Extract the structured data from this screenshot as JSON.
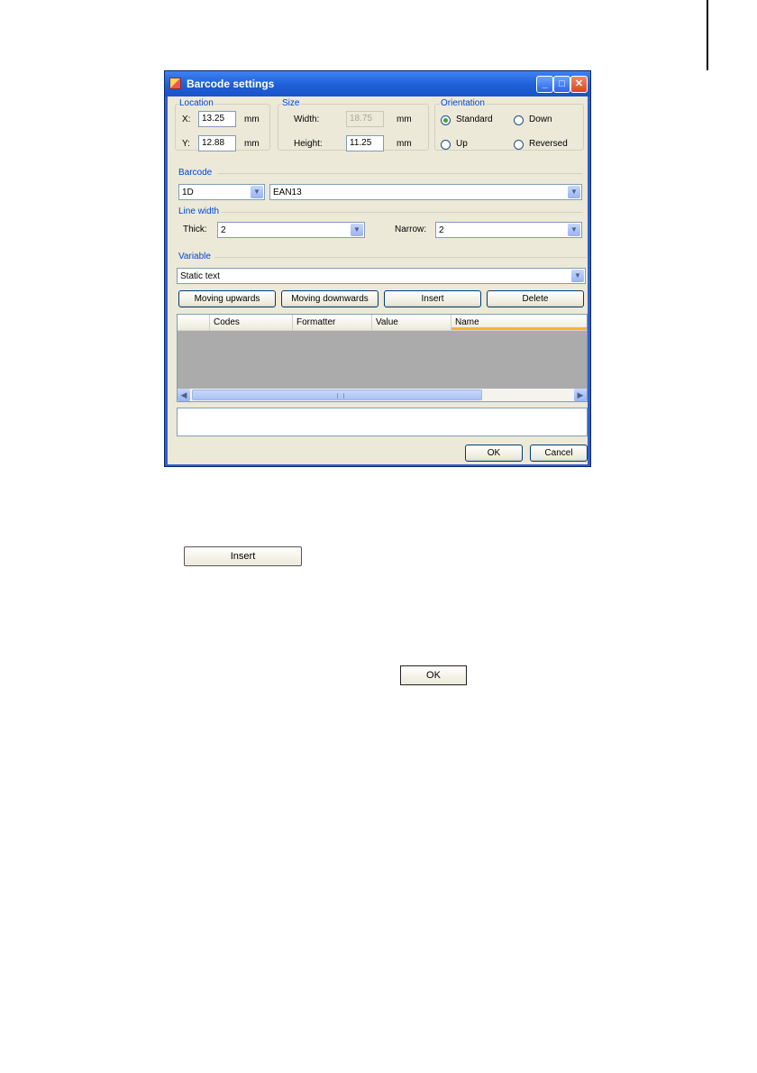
{
  "window": {
    "title": "Barcode settings",
    "controls": {
      "minimize": "_",
      "maximize": "□",
      "close": "✕"
    }
  },
  "location": {
    "group_label": "Location",
    "x_label": "X:",
    "x_value": "13.25",
    "x_unit": "mm",
    "y_label": "Y:",
    "y_value": "12.88",
    "y_unit": "mm"
  },
  "size": {
    "group_label": "Size",
    "width_label": "Width:",
    "width_value": "18.75",
    "width_unit": "mm",
    "height_label": "Height:",
    "height_value": "11.25",
    "height_unit": "mm"
  },
  "orientation": {
    "group_label": "Orientation",
    "options": [
      "Standard",
      "Down",
      "Up",
      "Reversed"
    ],
    "selected": "Standard"
  },
  "barcode": {
    "group_label": "Barcode",
    "dimension": "1D",
    "type": "EAN13"
  },
  "line_width": {
    "group_label": "Line width",
    "thick_label": "Thick:",
    "thick_value": "2",
    "narrow_label": "Narrow:",
    "narrow_value": "2"
  },
  "variable": {
    "group_label": "Variable",
    "selected": "Static text",
    "buttons": [
      "Moving upwards",
      "Moving downwards",
      "Insert",
      "Delete"
    ],
    "columns": [
      "",
      "Codes",
      "Formatter",
      "Value",
      "Name"
    ],
    "memo_text": ""
  },
  "dialog_buttons": {
    "ok": "OK",
    "cancel": "Cancel"
  },
  "standalone": {
    "insert_button": "Insert",
    "ok_button": "OK"
  },
  "colors": {
    "titlebar": "#1f5fd6",
    "dialog_bg": "#ece9d8",
    "group_label": "#0046d5",
    "grid_bg": "#ababab",
    "active_column_indicator": "#f9b334"
  },
  "icons": [
    "app-icon",
    "minimize-icon",
    "maximize-icon",
    "close-icon",
    "chevron-down-icon",
    "scroll-left-icon",
    "scroll-right-icon"
  ]
}
